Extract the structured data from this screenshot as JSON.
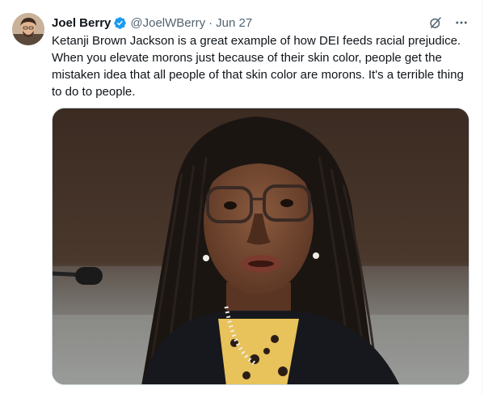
{
  "tweet": {
    "author": {
      "display_name": "Joel Berry",
      "handle": "@JoelWBerry",
      "verified": true
    },
    "separator": "·",
    "date": "Jun 27",
    "text": "Ketanji Brown Jackson is a great example of how DEI feeds racial prejudice. When you elevate morons just because of their skin color, people get the mistaken idea that all people of that skin color are morons. It's a terrible thing to do to people.",
    "icons": {
      "grok": "grok-icon",
      "more": "more-options-icon",
      "verified": "verified-badge-icon"
    },
    "media": {
      "type": "photo"
    }
  },
  "colors": {
    "accent": "#1d9bf0",
    "secondary_text": "#536471",
    "primary_text": "#0f1419"
  }
}
